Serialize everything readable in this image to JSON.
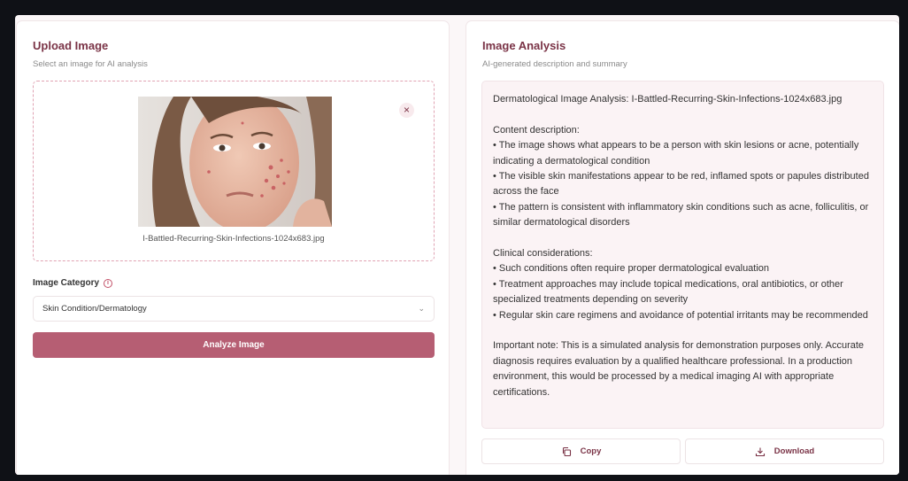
{
  "upload_panel": {
    "title": "Upload Image",
    "subtitle": "Select an image for AI analysis",
    "filename": "I-Battled-Recurring-Skin-Infections-1024x683.jpg",
    "remove_icon": "close-icon",
    "category_label": "Image Category",
    "category_value": "Skin Condition/Dermatology",
    "analyze_label": "Analyze Image"
  },
  "analysis_panel": {
    "title": "Image Analysis",
    "subtitle": "AI-generated description and summary",
    "lines": [
      "Dermatological Image Analysis: I-Battled-Recurring-Skin-Infections-1024x683.jpg",
      "",
      "Content description:",
      "• The image shows what appears to be a person with skin lesions or acne, potentially indicating a dermatological condition",
      "• The visible skin manifestations appear to be red, inflamed spots or papules distributed across the face",
      "• The pattern is consistent with inflammatory skin conditions such as acne, folliculitis, or similar dermatological disorders",
      "",
      "Clinical considerations:",
      "• Such conditions often require proper dermatological evaluation",
      "• Treatment approaches may include topical medications, oral antibiotics, or other specialized treatments depending on severity",
      "• Regular skin care regimens and avoidance of potential irritants may be recommended",
      "",
      "Important note: This is a simulated analysis for demonstration purposes only. Accurate diagnosis requires evaluation by a qualified healthcare professional. In a production environment, this would be processed by a medical imaging AI with appropriate certifications."
    ],
    "copy_label": "Copy",
    "download_label": "Download"
  },
  "colors": {
    "accent": "#b65e73",
    "title": "#7a3346",
    "dashed_border": "#e0a3b3",
    "result_bg": "#fbf3f5"
  }
}
